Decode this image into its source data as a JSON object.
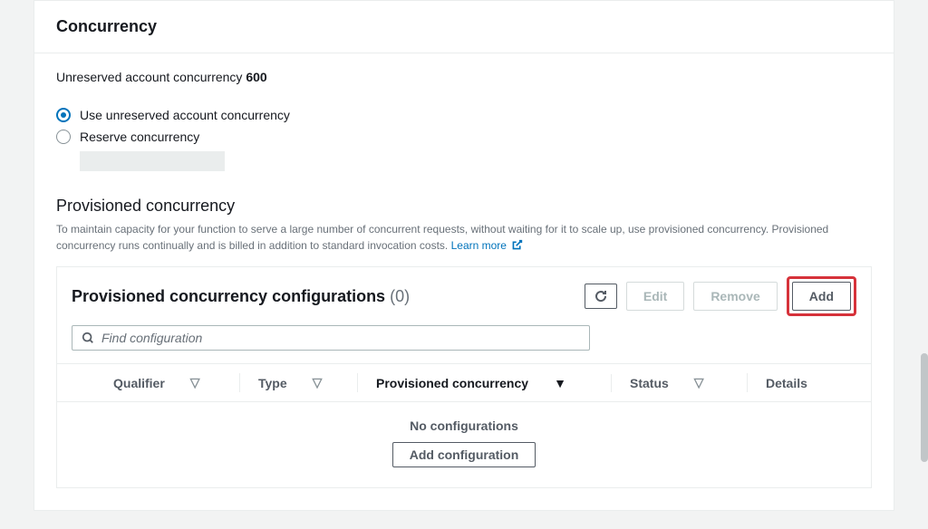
{
  "panel": {
    "title": "Concurrency",
    "unreserved_label": "Unreserved account concurrency",
    "unreserved_value": "600"
  },
  "radios": {
    "use_unreserved": "Use unreserved account concurrency",
    "reserve": "Reserve concurrency"
  },
  "provisioned": {
    "heading": "Provisioned concurrency",
    "desc_a": "To maintain capacity for your function to serve a large number of concurrent requests, without waiting for it to scale up, use provisioned concurrency. Provisioned concurrency runs continually and is billed in addition to standard invocation costs.",
    "learn_more": "Learn more"
  },
  "config_panel": {
    "title": "Provisioned concurrency configurations",
    "count": "(0)",
    "buttons": {
      "edit": "Edit",
      "remove": "Remove",
      "add": "Add"
    },
    "search_placeholder": "Find configuration",
    "columns": {
      "qualifier": "Qualifier",
      "type": "Type",
      "provisioned": "Provisioned concurrency",
      "status": "Status",
      "details": "Details"
    },
    "empty": {
      "title": "No configurations",
      "button": "Add configuration"
    }
  }
}
